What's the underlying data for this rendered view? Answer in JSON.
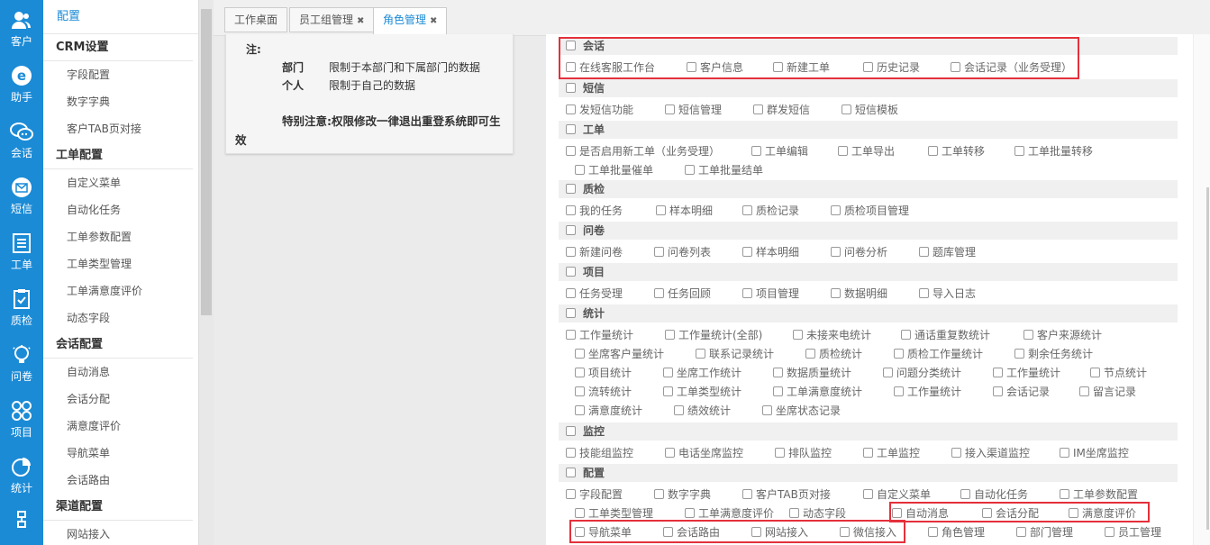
{
  "rail": [
    {
      "label": "客户",
      "icon": "person-icon"
    },
    {
      "label": "助手",
      "icon": "browser-icon"
    },
    {
      "label": "会话",
      "icon": "chat-icon"
    },
    {
      "label": "短信",
      "icon": "envelope-icon"
    },
    {
      "label": "工单",
      "icon": "clipboard-icon"
    },
    {
      "label": "质检",
      "icon": "checklist-icon"
    },
    {
      "label": "问卷",
      "icon": "bulb-icon"
    },
    {
      "label": "项目",
      "icon": "grid-icon"
    },
    {
      "label": "统计",
      "icon": "pie-chart-icon"
    }
  ],
  "menu": {
    "top": "配置",
    "groups": [
      {
        "title": "CRM设置",
        "items": [
          "字段配置",
          "数字字典",
          "客户TAB页对接"
        ]
      },
      {
        "title": "工单配置",
        "items": [
          "自定义菜单",
          "自动化任务",
          "工单参数配置",
          "工单类型管理",
          "工单满意度评价",
          "动态字段"
        ]
      },
      {
        "title": "会话配置",
        "items": [
          "自动消息",
          "会话分配",
          "满意度评价",
          "导航菜单",
          "会话路由"
        ]
      },
      {
        "title": "渠道配置",
        "items": [
          "网站接入"
        ]
      }
    ]
  },
  "tabs": [
    {
      "label": "工作桌面",
      "closable": false
    },
    {
      "label": "员工组管理",
      "closable": true
    },
    {
      "label": "角色管理",
      "closable": true,
      "active": true
    }
  ],
  "note": {
    "label": "注:",
    "rows": [
      {
        "k": "部门",
        "v": "限制于本部门和下属部门的数据"
      },
      {
        "k": "个人",
        "v": "限制于自己的数据"
      }
    ],
    "warning": "特别注意:权限修改一律退出重登系统即可生效"
  },
  "sections": [
    {
      "title": "会话",
      "rows": [
        [
          "在线客服工作台",
          "客户信息",
          "新建工单",
          "历史记录",
          "会话记录（业务受理）"
        ]
      ]
    },
    {
      "title": "短信",
      "rows": [
        [
          "发短信功能",
          "短信管理",
          "群发短信",
          "短信模板"
        ]
      ]
    },
    {
      "title": "工单",
      "rows": [
        [
          "是否启用新工单（业务受理）",
          "工单编辑",
          "工单导出",
          "工单转移",
          "工单批量转移"
        ],
        [
          "工单批量催单",
          "工单批量结单"
        ]
      ]
    },
    {
      "title": "质检",
      "rows": [
        [
          "我的任务",
          "样本明细",
          "质检记录",
          "质检项目管理"
        ]
      ]
    },
    {
      "title": "问卷",
      "rows": [
        [
          "新建问卷",
          "问卷列表",
          "样本明细",
          "问卷分析",
          "题库管理"
        ]
      ]
    },
    {
      "title": "项目",
      "rows": [
        [
          "任务受理",
          "任务回顾",
          "项目管理",
          "数据明细",
          "导入日志"
        ]
      ]
    },
    {
      "title": "统计",
      "rows": [
        [
          "工作量统计",
          "工作量统计(全部)",
          "未接来电统计",
          "通话重复数统计",
          "客户来源统计"
        ],
        [
          "坐席客户量统计",
          "联系记录统计",
          "质检统计",
          "质检工作量统计",
          "剩余任务统计"
        ],
        [
          "项目统计",
          "坐席工作统计",
          "数据质量统计",
          "问题分类统计",
          "工作量统计",
          "节点统计"
        ],
        [
          "流转统计",
          "工单类型统计",
          "工单满意度统计",
          "工作量统计",
          "会话记录",
          "留言记录"
        ],
        [
          "满意度统计",
          "绩效统计",
          "坐席状态记录"
        ]
      ]
    },
    {
      "title": "监控",
      "rows": [
        [
          "技能组监控",
          "电话坐席监控",
          "排队监控",
          "工单监控",
          "接入渠道监控",
          "IM坐席监控"
        ]
      ]
    },
    {
      "title": "配置",
      "rows": [
        [
          "字段配置",
          "数字字典",
          "客户TAB页对接",
          "自定义菜单",
          "自动化任务",
          "工单参数配置"
        ],
        [
          "工单类型管理",
          "工单满意度评价",
          "动态字段",
          "自动消息",
          "会话分配",
          "满意度评价"
        ],
        [
          "导航菜单",
          "会话路由",
          "网站接入",
          "微信接入",
          "角色管理",
          "部门管理",
          "员工管理"
        ]
      ]
    }
  ]
}
